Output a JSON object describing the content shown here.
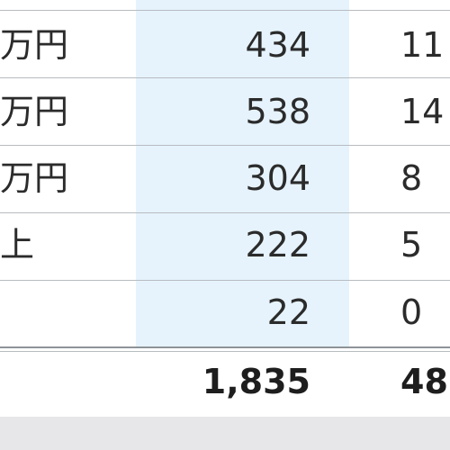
{
  "table": {
    "rows": [
      {
        "label": "万円",
        "value": "434",
        "value2": "11"
      },
      {
        "label": "万円",
        "value": "538",
        "value2": "14"
      },
      {
        "label": "万円",
        "value": "304",
        "value2": "8"
      },
      {
        "label": "上",
        "value": "222",
        "value2": "5"
      },
      {
        "label": "",
        "value": "22",
        "value2": "0"
      }
    ],
    "total": {
      "label": "",
      "value": "1,835",
      "value2": "48"
    }
  },
  "colors": {
    "highlight_column": "#e6f3fc",
    "rule": "#b7bcc0",
    "footer": "#e7e7e9"
  }
}
